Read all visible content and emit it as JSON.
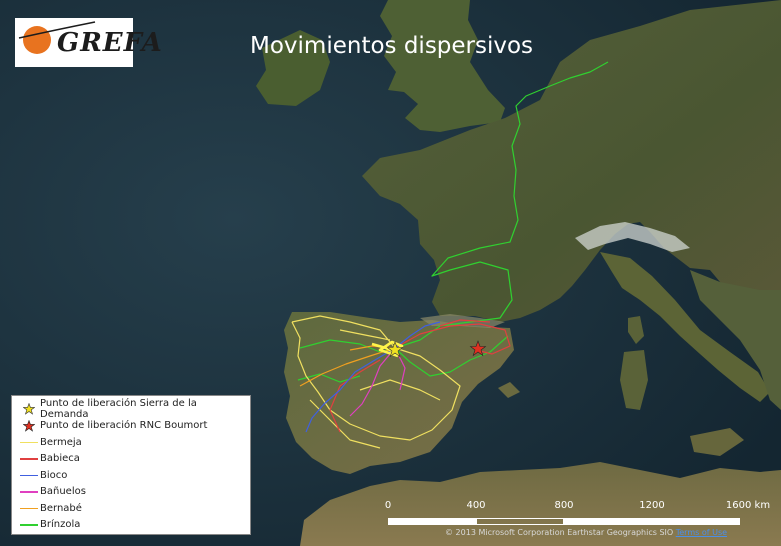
{
  "title": "Movimientos dispersivos",
  "logo": {
    "text": "GREFA",
    "accent_color": "#e8731f"
  },
  "legend": {
    "items": [
      {
        "label": "Punto de liberación Sierra de la Demanda",
        "symbol": "star",
        "color": "#f0e020"
      },
      {
        "label": "Punto de liberación RNC Boumort",
        "symbol": "star",
        "color": "#e03020"
      },
      {
        "label": "Bermeja",
        "symbol": "line",
        "color": "#f0e060"
      },
      {
        "label": "Babieca",
        "symbol": "line",
        "color": "#e04040"
      },
      {
        "label": "Bioco",
        "symbol": "line",
        "color": "#4060e0"
      },
      {
        "label": "Bañuelos",
        "symbol": "line",
        "color": "#e040c0"
      },
      {
        "label": "Bernabé",
        "symbol": "line",
        "color": "#f0a020"
      },
      {
        "label": "Brínzola",
        "symbol": "line",
        "color": "#30d030"
      }
    ]
  },
  "scale": {
    "labels": [
      "0",
      "400",
      "800",
      "1200",
      "1600 km"
    ]
  },
  "attribution": {
    "text": "© 2013 Microsoft Corporation Earthstar Geographics SIO",
    "link": "Terms of Use"
  },
  "colors": {
    "sea": "#1c3442",
    "land": "#4d5a34",
    "land_dark": "#3a472a",
    "snow": "#d4d9d6",
    "ireland": "#4a5e30"
  }
}
